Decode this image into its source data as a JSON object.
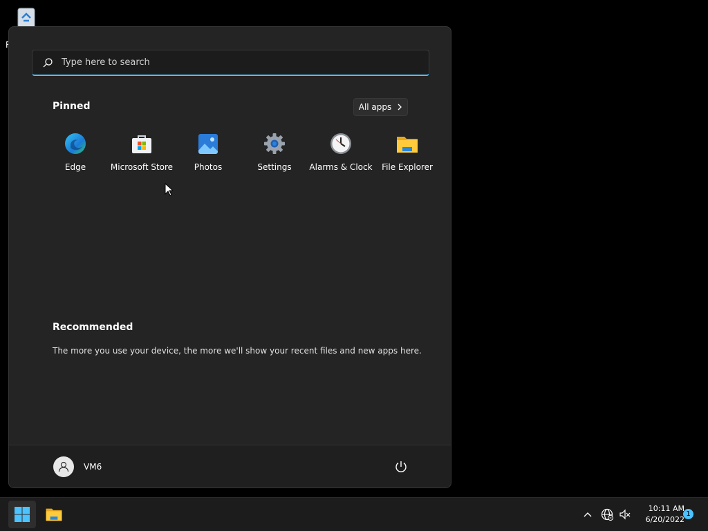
{
  "desktop": {
    "recycle_bin_label": "R"
  },
  "start_menu": {
    "search": {
      "placeholder": "Type here to search"
    },
    "pinned": {
      "title": "Pinned",
      "all_apps_label": "All apps",
      "apps": [
        {
          "label": "Edge",
          "icon": "edge-icon"
        },
        {
          "label": "Microsoft Store",
          "icon": "microsoft-store-icon"
        },
        {
          "label": "Photos",
          "icon": "photos-icon"
        },
        {
          "label": "Settings",
          "icon": "settings-icon"
        },
        {
          "label": "Alarms & Clock",
          "icon": "alarms-clock-icon"
        },
        {
          "label": "File Explorer",
          "icon": "file-explorer-icon"
        }
      ]
    },
    "recommended": {
      "title": "Recommended",
      "empty_text": "The more you use your device, the more we'll show your recent files and new apps here."
    },
    "user": {
      "name": "VM6"
    }
  },
  "taskbar": {
    "time": "10:11 AM",
    "date": "6/20/2022",
    "notification_count": "1"
  },
  "colors": {
    "accent": "#4cc2ff",
    "menu_bg": "#242424",
    "taskbar_bg": "#1c1c1c"
  }
}
